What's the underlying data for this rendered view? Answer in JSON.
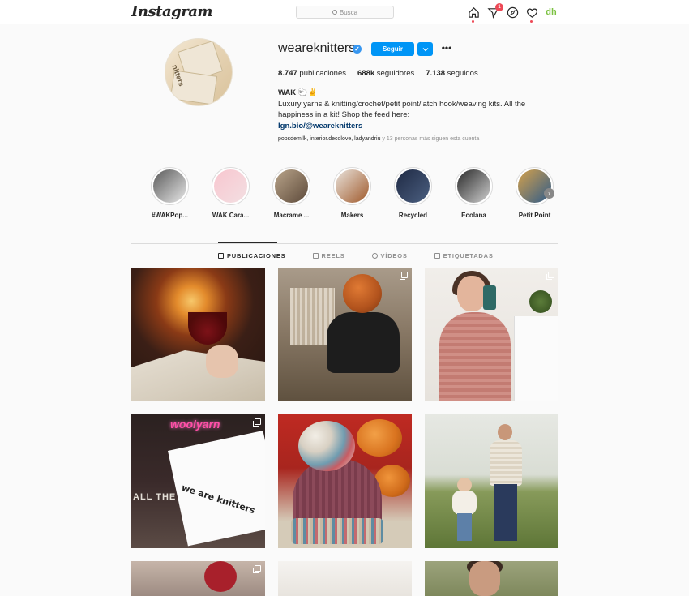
{
  "nav": {
    "logo": "Instagram",
    "search_placeholder": "Busca",
    "notifications_count": "1"
  },
  "profile": {
    "username": "weareknitters",
    "verified": true,
    "follow_label": "Seguir",
    "more_label": "•••",
    "stats": {
      "posts": "8.747",
      "posts_label": " publicaciones",
      "followers": "688k",
      "followers_label": " seguidores",
      "following": "7.138",
      "following_label": " seguidos"
    },
    "bio": {
      "name": "WAK 🐑✌",
      "text": "Luxury yarns & knitting/crochet/petit point/latch hook/weaving kits. All the happiness in a kit! Shop the feed here:",
      "link": "lgn.bio/@weareknitters"
    },
    "followed_by": {
      "names": "popsdemilk, interior.decolove, ladyandriu",
      "suffix": " y 13 personas más siguen esta cuenta"
    }
  },
  "highlights": [
    {
      "label": "#WAKPop...",
      "colors": [
        "#5a5a5a",
        "#e8e8e8"
      ]
    },
    {
      "label": "WAK Cara...",
      "colors": [
        "#f8c6cf",
        "#f3dfe2"
      ]
    },
    {
      "label": "Macrame ...",
      "colors": [
        "#b9a48a",
        "#5d4a3a"
      ]
    },
    {
      "label": "Makers",
      "colors": [
        "#e9e3dc",
        "#a05a2c"
      ]
    },
    {
      "label": "Recycled",
      "colors": [
        "#1f2a44",
        "#4b5f80"
      ]
    },
    {
      "label": "Ecolana",
      "colors": [
        "#2a2a2a",
        "#cfcfcf"
      ]
    },
    {
      "label": "Petit Point",
      "colors": [
        "#d4a14b",
        "#2f5b8a"
      ]
    }
  ],
  "tabs": [
    {
      "label": "PUBLICACIONES",
      "icon": "grid-icon",
      "active": true
    },
    {
      "label": "REELS",
      "icon": "reels-icon",
      "active": false
    },
    {
      "label": "VÍDEOS",
      "icon": "video-icon",
      "active": false
    },
    {
      "label": "ETIQUETADAS",
      "icon": "tagged-icon",
      "active": false
    }
  ],
  "posts": {
    "p4_neon": "woolyarn",
    "p4_bag": "we are knitters",
    "p4_side": "ALL THE"
  },
  "colors": {
    "accent": "#0095f6",
    "badge": "#ed4956",
    "link": "#00376b"
  }
}
